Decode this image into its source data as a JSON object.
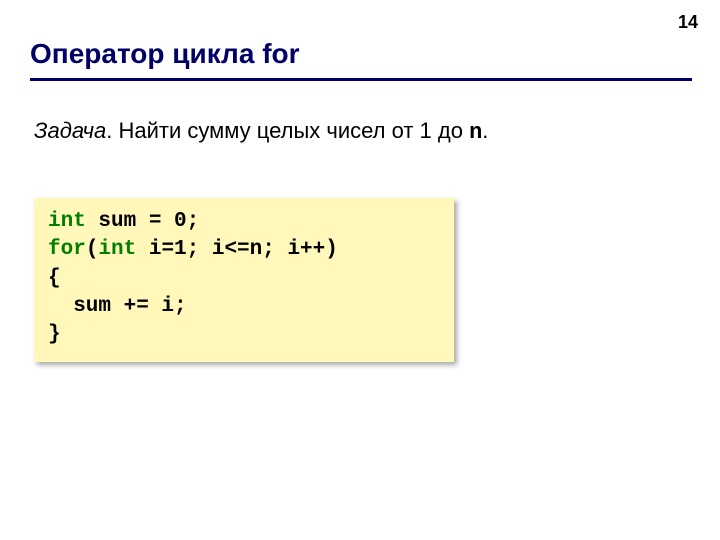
{
  "page_number": "14",
  "title": "Оператор цикла for",
  "task": {
    "label_em": "Задача",
    "text_before": ". Найти сумму целых чисел от 1 до ",
    "n": "n",
    "text_after": "."
  },
  "code": {
    "l1_kw": "int",
    "l1_rest": " sum = 0;",
    "l2_kw1": "for",
    "l2_mid": "(",
    "l2_kw2": "int",
    "l2_rest": " i=1; i<=n; i++)",
    "l3": "{",
    "l4": "  sum += i;",
    "l5": "}"
  }
}
